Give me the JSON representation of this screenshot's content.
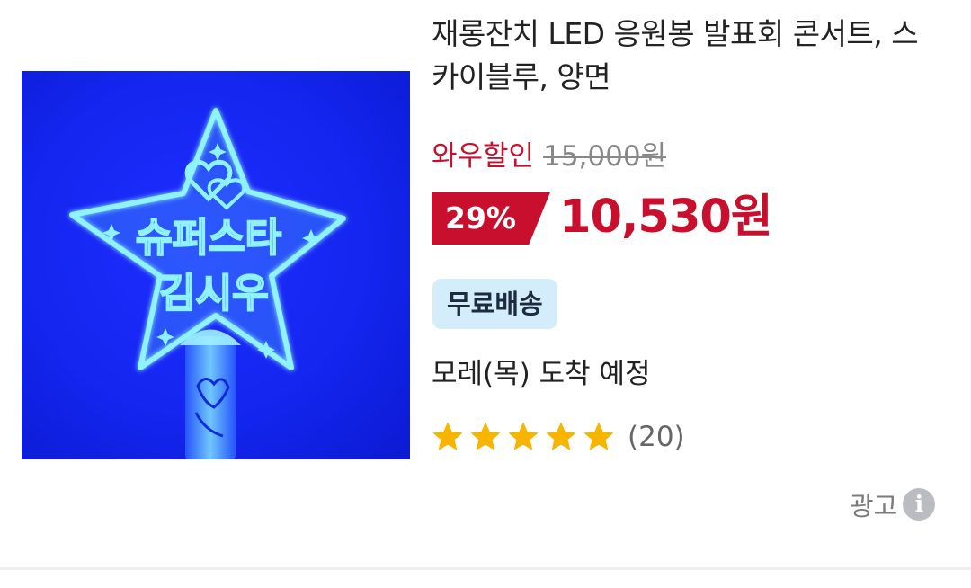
{
  "product": {
    "title": "재롱잔치 LED 응원봉 발표회 콘서트, 스카이블루, 양면",
    "image": {
      "depicted_text_line1": "슈퍼스타",
      "depicted_text_line2": "김시우",
      "background_color": "#1426f0",
      "glow_color": "#7ee6ff"
    },
    "wow_label": "와우할인",
    "original_price": "15,000원",
    "discount_rate": "29%",
    "sale_price": "10,530원",
    "shipping_badge": "무료배송",
    "arrival": "모레(목) 도착 예정",
    "rating": {
      "stars": 5,
      "max": 5,
      "review_count": "(20)"
    }
  },
  "ad": {
    "label": "광고",
    "info_glyph": "i"
  },
  "colors": {
    "sale_red": "#c8102e",
    "star_yellow": "#f7b500",
    "badge_bg": "#d4edfb"
  },
  "icons": {
    "star": "star-icon",
    "info": "info-icon"
  }
}
